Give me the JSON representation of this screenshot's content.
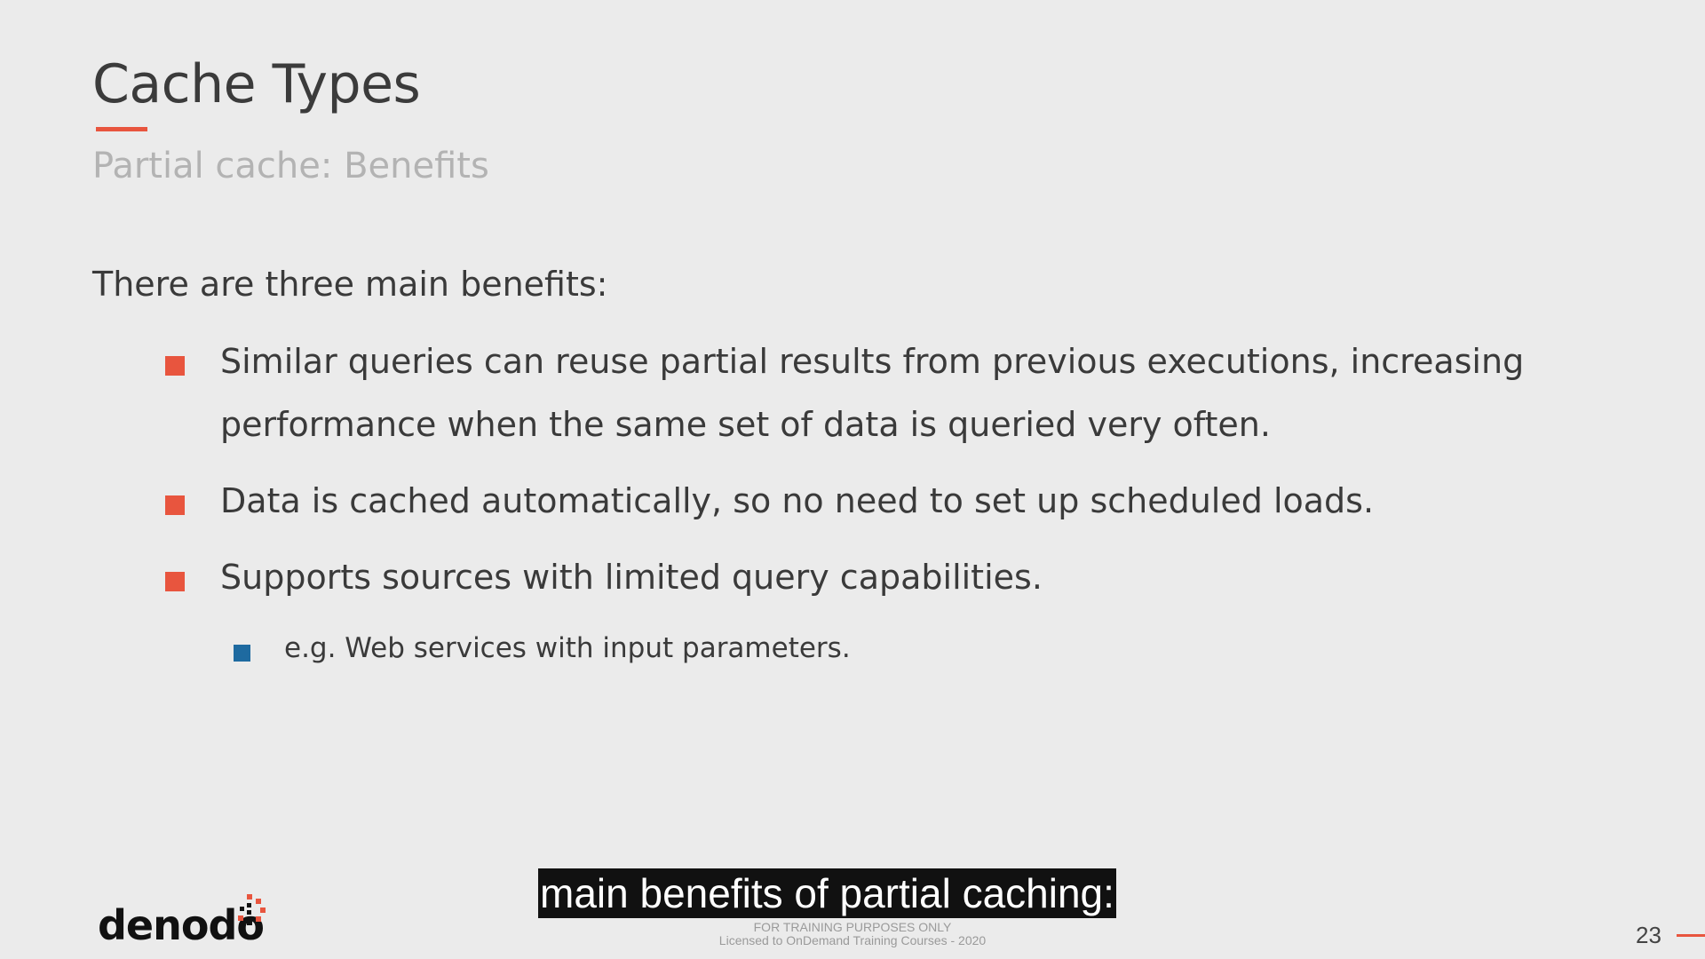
{
  "slide": {
    "title": "Cache Types",
    "subtitle": "Partial cache: Benefits",
    "intro": "There are three main benefits:",
    "bullets": [
      {
        "lines": [
          "Similar queries can reuse partial results from previous executions, increasing",
          "performance when the same set of data is queried very often."
        ]
      },
      {
        "lines": [
          "Data is cached automatically, so no need to set up scheduled loads."
        ]
      },
      {
        "lines": [
          "Supports sources with limited query capabilities."
        ]
      }
    ],
    "sub_bullet": "e.g. Web services with input parameters.",
    "page_number": "23",
    "footer_line1": "FOR TRAINING PURPOSES ONLY",
    "footer_line2": "Licensed to OnDemand Training Courses - 2020"
  },
  "brand": {
    "logo_text": "denodo",
    "accent_color": "#e8553e",
    "sub_bullet_color": "#1e6aa0"
  },
  "video": {
    "caption": "main benefits of partial caching:"
  }
}
